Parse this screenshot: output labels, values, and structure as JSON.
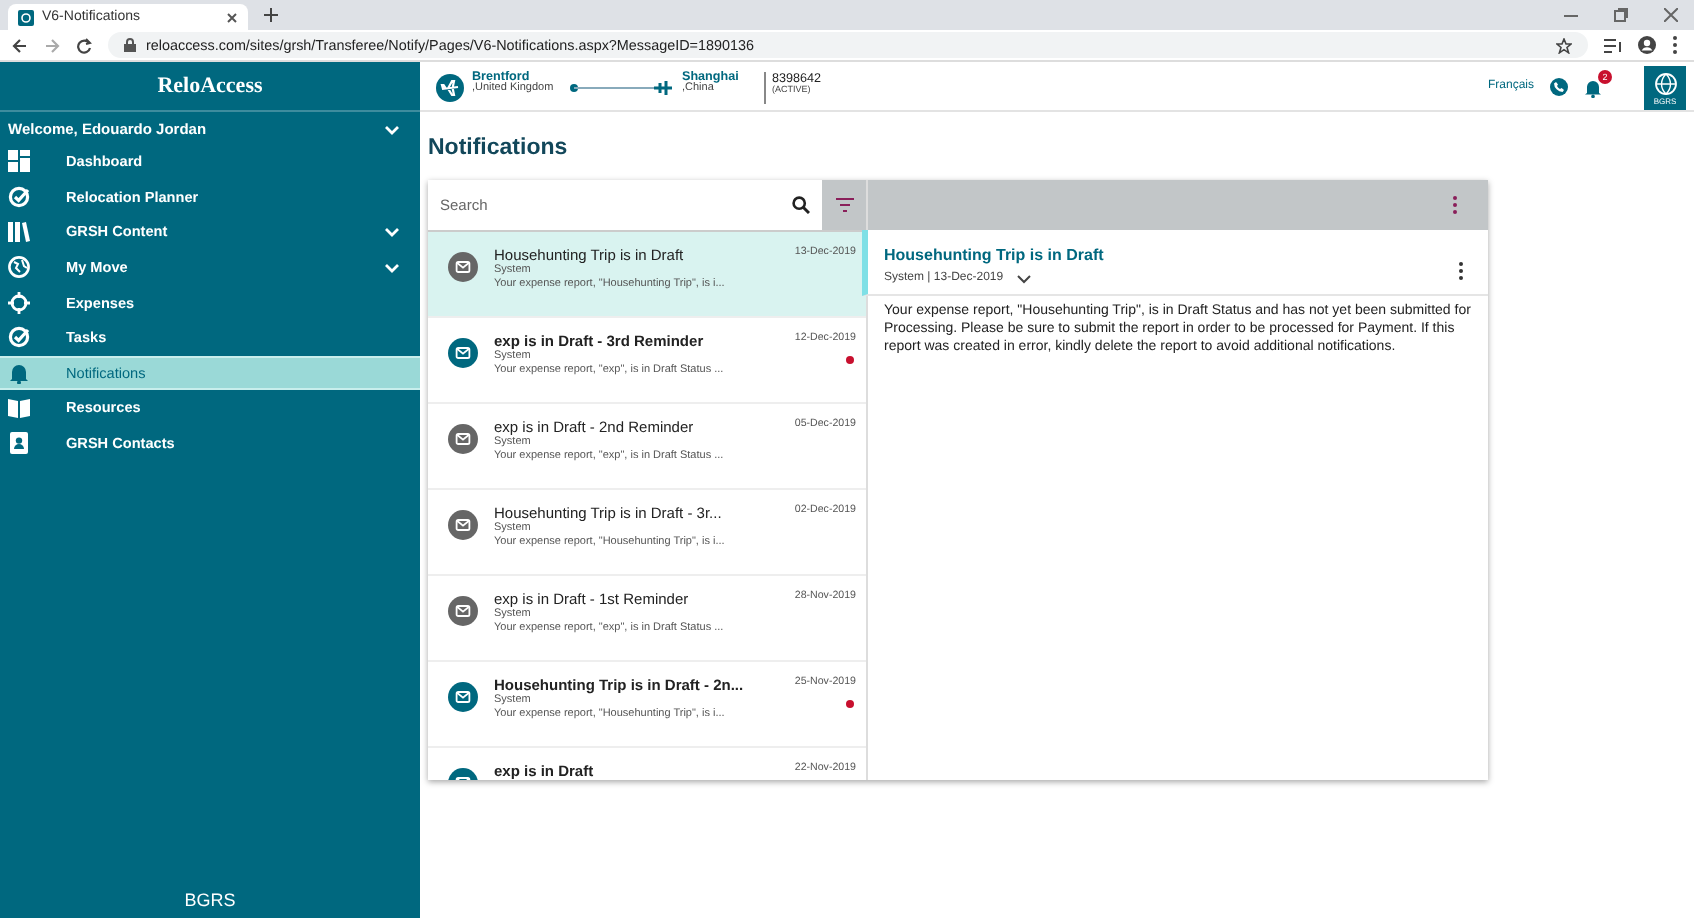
{
  "browser": {
    "tab_title": "V6-Notifications",
    "url": "reloaccess.com/sites/grsh/Transferee/Notify/Pages/V6-Notifications.aspx?MessageID=1890136"
  },
  "sidebar": {
    "brand": "ReloAccess",
    "welcome": "Welcome, Edouardo Jordan",
    "items": [
      {
        "label": "Dashboard",
        "expandable": false,
        "selected": false
      },
      {
        "label": "Relocation Planner",
        "expandable": false,
        "selected": false
      },
      {
        "label": "GRSH Content",
        "expandable": true,
        "selected": false
      },
      {
        "label": "My Move",
        "expandable": true,
        "selected": false
      },
      {
        "label": "Expenses",
        "expandable": false,
        "selected": false
      },
      {
        "label": "Tasks",
        "expandable": false,
        "selected": false
      },
      {
        "label": "Notifications",
        "expandable": false,
        "selected": true
      },
      {
        "label": "Resources",
        "expandable": false,
        "selected": false
      },
      {
        "label": "GRSH Contacts",
        "expandable": false,
        "selected": false
      }
    ],
    "footer_logo": "BGRS"
  },
  "header": {
    "origin": {
      "city": "Brentford",
      "country": ",United Kingdom"
    },
    "destination": {
      "city": "Shanghai",
      "country": ",China"
    },
    "file_number": "8398642",
    "file_status": "(ACTIVE)",
    "language_link": "Français",
    "notification_count": "2",
    "logo_text": "BGRS"
  },
  "page_title": "Notifications",
  "search": {
    "placeholder": "Search"
  },
  "notifications": [
    {
      "title": "Househunting Trip is in Draft",
      "sender": "System",
      "preview": "Your expense report, \"Househunting Trip\", is i...",
      "date": "13-Dec-2019",
      "unread": false,
      "selected": true
    },
    {
      "title": "exp is in Draft - 3rd Reminder",
      "sender": "System",
      "preview": "Your expense report, \"exp\", is in Draft Status ...",
      "date": "12-Dec-2019",
      "unread": true,
      "selected": false
    },
    {
      "title": "exp is in Draft - 2nd Reminder",
      "sender": "System",
      "preview": "Your expense report, \"exp\", is in Draft Status ...",
      "date": "05-Dec-2019",
      "unread": false,
      "selected": false
    },
    {
      "title": "Househunting Trip is in Draft - 3r...",
      "sender": "System",
      "preview": "Your expense report, \"Househunting Trip\", is i...",
      "date": "02-Dec-2019",
      "unread": false,
      "selected": false
    },
    {
      "title": "exp is in Draft - 1st Reminder",
      "sender": "System",
      "preview": "Your expense report, \"exp\", is in Draft Status ...",
      "date": "28-Nov-2019",
      "unread": false,
      "selected": false
    },
    {
      "title": "Househunting Trip is in Draft - 2n...",
      "sender": "System",
      "preview": "Your expense report, \"Househunting Trip\", is i...",
      "date": "25-Nov-2019",
      "unread": true,
      "selected": false
    },
    {
      "title": "exp is in Draft",
      "date": "22-Nov-2019",
      "unread": true,
      "selected": false
    }
  ],
  "detail": {
    "title": "Househunting Trip is in Draft",
    "meta": "System | 13-Dec-2019",
    "body": "Your expense report, \"Househunting Trip\", is in Draft Status and has not yet been submitted for Processing. Please be sure to submit the report in order to be processed for Payment. If this report was created in error, kindly delete the report to avoid additional notifications."
  }
}
